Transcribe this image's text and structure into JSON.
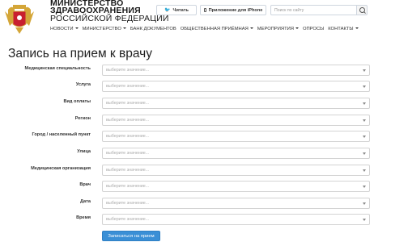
{
  "header": {
    "ministry_line1": "МИНИСТЕРСТВО",
    "ministry_line2": "ЗДРАВООХРАНЕНИЯ",
    "ministry_line3": "РОССИЙСКОЙ ФЕДЕРАЦИИ",
    "read_button": "Читать",
    "iphone_button": "Приложение для iPhone",
    "search_placeholder": "Поиск по сайту",
    "icons": [
      "emblem-icon",
      "twitter-icon",
      "phone-icon",
      "search-icon"
    ]
  },
  "nav": {
    "items": [
      {
        "label": "НОВОСТИ",
        "dropdown": true
      },
      {
        "label": "МИНИСТЕРСТВО",
        "dropdown": true
      },
      {
        "label": "БАНК ДОКУМЕНТОВ",
        "dropdown": false
      },
      {
        "label": "ОБЩЕСТВЕННАЯ ПРИЁМНАЯ",
        "dropdown": true
      },
      {
        "label": "МЕРОПРИЯТИЯ",
        "dropdown": true
      },
      {
        "label": "ОПРОСЫ",
        "dropdown": false
      },
      {
        "label": "КОНТАКТЫ",
        "dropdown": true
      }
    ]
  },
  "page": {
    "title": "Запись на прием к врачу"
  },
  "form": {
    "select_placeholder": "выберите значение...",
    "fields": [
      {
        "label": "Медицинская специальность"
      },
      {
        "label": "Услуга"
      },
      {
        "label": "Вид оплаты"
      },
      {
        "label": "Регион"
      },
      {
        "label": "Город / населенный пункт"
      },
      {
        "label": "Улица"
      },
      {
        "label": "Медицинская организация"
      },
      {
        "label": "Врач"
      },
      {
        "label": "Дата"
      },
      {
        "label": "Время"
      }
    ],
    "submit_label": "Записаться на прием"
  },
  "colors": {
    "accent": "#3a8fd6",
    "border": "#d3d3d3",
    "emblem_red": "#c8202f",
    "emblem_gold": "#d4a638"
  }
}
